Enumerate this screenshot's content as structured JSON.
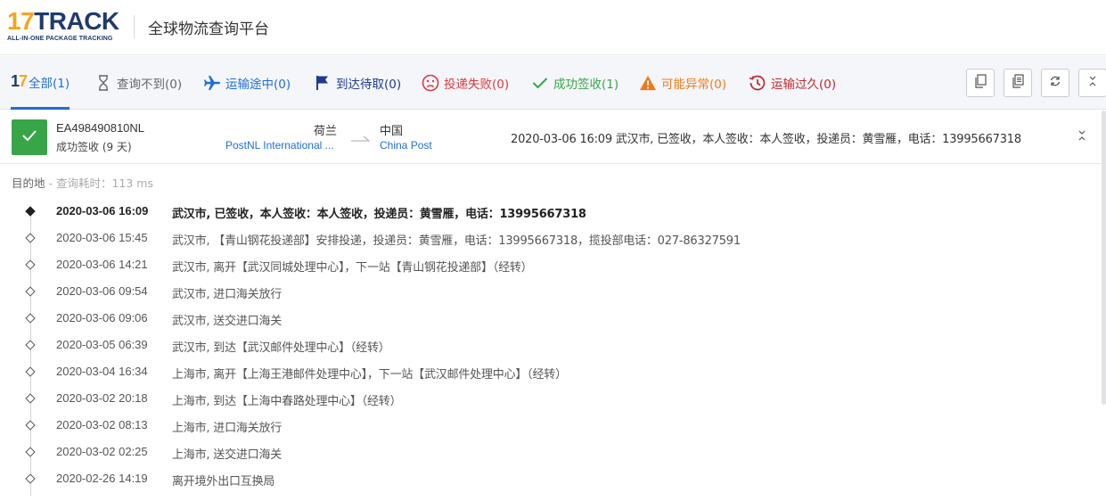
{
  "header": {
    "logo_number": "17",
    "logo_text": "TRACK",
    "logo_subtitle": "ALL-IN-ONE PACKAGE TRACKING",
    "title": "全球物流查询平台"
  },
  "tabs": [
    {
      "label": "全部(1)",
      "icon": "17track-brand-icon",
      "color": "#1f6ed4",
      "active": true
    },
    {
      "label": "查询不到(0)",
      "icon": "hourglass-icon",
      "color": "#666666"
    },
    {
      "label": "运输途中(0)",
      "icon": "airplane-icon",
      "color": "#1f6ed4"
    },
    {
      "label": "到达待取(0)",
      "icon": "flag-icon",
      "color": "#1f3a8e"
    },
    {
      "label": "投递失败(0)",
      "icon": "sad-face-icon",
      "color": "#e0383e"
    },
    {
      "label": "成功签收(1)",
      "icon": "checkmark-icon",
      "color": "#38a548"
    },
    {
      "label": "可能异常(0)",
      "icon": "warning-icon",
      "color": "#f07a1a"
    },
    {
      "label": "运输过久(0)",
      "icon": "clock-history-icon",
      "color": "#c0282e"
    }
  ],
  "toolbar": {
    "buttons": [
      "copy-icon",
      "copy-list-icon",
      "refresh-icon",
      "collapse-icon"
    ]
  },
  "package": {
    "tracking_number": "EA498490810NL",
    "status": "成功签收 (9 天)",
    "status_color": "#38a548",
    "origin_country": "荷兰",
    "origin_carrier": "PostNL International ...",
    "dest_country": "中国",
    "dest_carrier": "China Post",
    "latest_event": "2020-03-06 16:09  武汉市, 已签收，本人签收：本人签收，投递员：黄雪雁，电话：13995667318"
  },
  "detail": {
    "dest_label": "目的地",
    "query_time": " - 查询耗时：113 ms"
  },
  "events": [
    {
      "time": "2020-03-06 16:09",
      "desc": "武汉市, 已签收，本人签收：本人签收，投递员：黄雪雁，电话：13995667318"
    },
    {
      "time": "2020-03-06 15:45",
      "desc": "武汉市, 【青山钢花投递部】安排投递，投递员：黄雪雁，电话：13995667318，揽投部电话：027-86327591"
    },
    {
      "time": "2020-03-06 14:21",
      "desc": "武汉市, 离开【武汉同城处理中心】，下一站【青山钢花投递部】（经转）"
    },
    {
      "time": "2020-03-06 09:54",
      "desc": "武汉市, 进口海关放行"
    },
    {
      "time": "2020-03-06 09:06",
      "desc": "武汉市, 送交进口海关"
    },
    {
      "time": "2020-03-05 06:39",
      "desc": "武汉市, 到达【武汉邮件处理中心】（经转）"
    },
    {
      "time": "2020-03-04 16:34",
      "desc": "上海市, 离开【上海王港邮件处理中心】，下一站【武汉邮件处理中心】（经转）"
    },
    {
      "time": "2020-03-02 20:18",
      "desc": "上海市, 到达【上海中春路处理中心】（经转）"
    },
    {
      "time": "2020-03-02 08:13",
      "desc": "上海市, 进口海关放行"
    },
    {
      "time": "2020-03-02 02:25",
      "desc": "上海市, 送交进口海关"
    },
    {
      "time": "2020-02-26 14:19",
      "desc": "离开境外出口互换局"
    }
  ]
}
